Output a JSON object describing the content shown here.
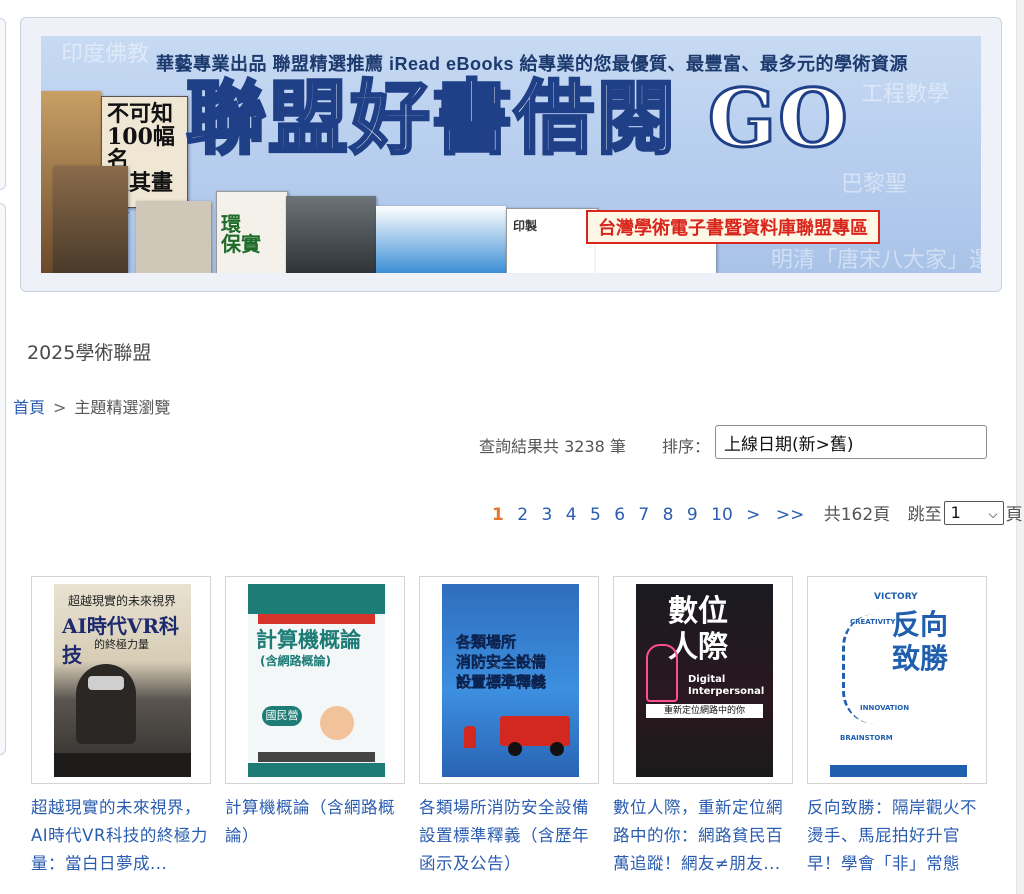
{
  "banner": {
    "tagline": "華藝專業出品 聯盟精選推薦 iRead eBooks 給專業的您最優質、最豐富、最多元的學術資源",
    "headline": "聯盟好書借閱 GO",
    "subtitle": "台灣學術電子書暨資料庫聯盟專區"
  },
  "site": {
    "title": "2025學術聯盟"
  },
  "breadcrumb": {
    "home": "首頁",
    "separator": ">",
    "current": "主題精選瀏覽"
  },
  "results": {
    "summary": "查詢結果共 3238 筆",
    "sort_label": "排序：",
    "sort_value": "上線日期(新>舊)"
  },
  "pager": {
    "pages": [
      "1",
      "2",
      "3",
      "4",
      "5",
      "6",
      "7",
      "8",
      "9",
      "10"
    ],
    "current": "1",
    "next": ">",
    "last": ">>",
    "total": "共162頁",
    "jump_label": "跳至",
    "jump_value": "1",
    "page_suffix": "頁"
  },
  "books": [
    {
      "title": "超越現實的未來視界，AI時代VR科技的終極力量：當白日夢成...",
      "cover": {
        "line1": "超越現實的未來視界",
        "line2": "AI時代VR科技",
        "line3": "的終極力量"
      }
    },
    {
      "title": "計算機概論（含網路概論）",
      "cover": {
        "line1": "計算機概論",
        "line2": "(含網路概論)",
        "badge": "國民營"
      }
    },
    {
      "title": "各類場所消防安全設備設置標準釋義（含歷年函示及公告）",
      "cover": {
        "line1": "各類場所",
        "line2": "消防安全設備",
        "line3": "設置標準釋義"
      }
    },
    {
      "title": "數位人際，重新定位網路中的你：網路貧民百萬追蹤！網友≠朋友...",
      "cover": {
        "line1": "數位",
        "line2": "人際",
        "en1": "Digital",
        "en2": "Interpersonal",
        "sub": "重新定位網路中的你"
      }
    },
    {
      "title": "反向致勝：隔岸觀火不燙手、馬屁拍好升官早！學會「非」常態",
      "cover": {
        "line1": "反向",
        "line2": "致勝",
        "w1": "VICTORY",
        "w2": "CREATIVITY",
        "w3": "INNOVATION",
        "w4": "BRAINSTORM"
      }
    }
  ],
  "colors": {
    "link": "#2a5db0",
    "current_page": "#e8752a",
    "banner_bg": "#b6cdee",
    "badge_red": "#d9261c"
  }
}
